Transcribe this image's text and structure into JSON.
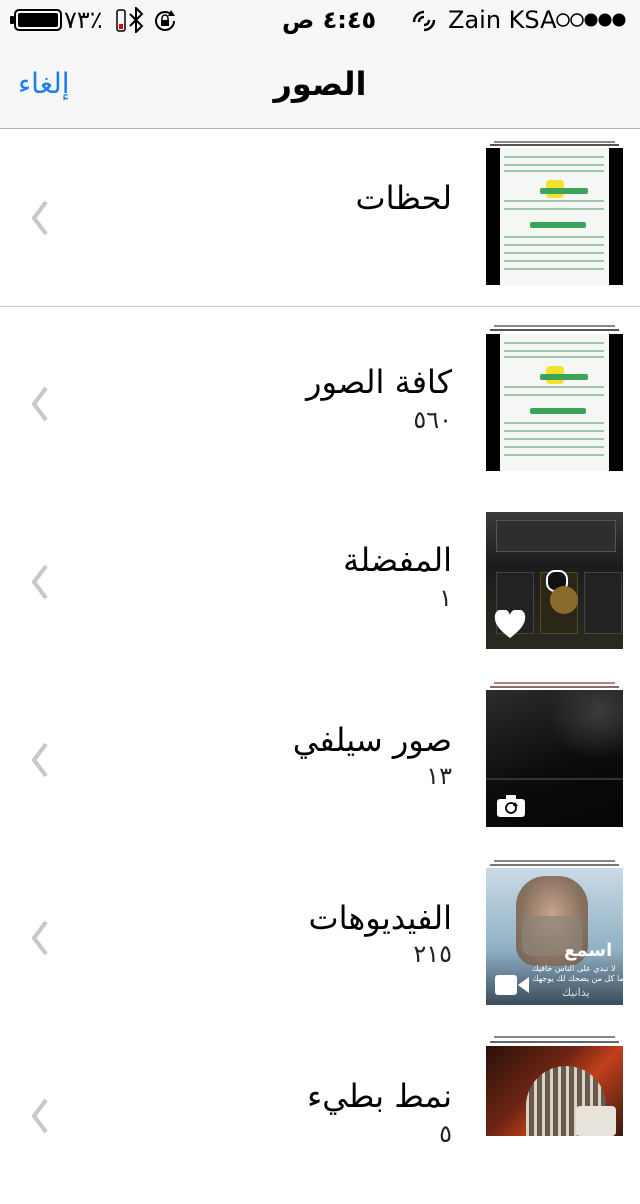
{
  "status_bar": {
    "battery_percent": "٧٣٪",
    "time": "٤:٤٥ ص",
    "carrier": "Zain KSA",
    "icons": [
      "battery-icon",
      "bluetooth-icon",
      "rotation-lock-icon",
      "wifi-calling-icon",
      "signal-dots-icon"
    ]
  },
  "nav": {
    "title": "الصور",
    "cancel_label": "إلغاء"
  },
  "albums": [
    {
      "label": "لحظات",
      "count": ""
    },
    {
      "label": "كافة الصور",
      "count": "٥٦٠"
    },
    {
      "label": "المفضلة",
      "count": "١"
    },
    {
      "label": "صور سيلفي",
      "count": "١٣"
    },
    {
      "label": "الفيديوهات",
      "count": "٢١٥"
    },
    {
      "label": "نمط بطيء",
      "count": "٥"
    }
  ],
  "thumb_text": {
    "quote_title": "اسمع",
    "quote_line1": "لا تبدي على الناس خافيك",
    "quote_line2": "ما كل من يضحك لك يوجهك",
    "quote_sig": "يدانيك"
  },
  "colors": {
    "accent": "#1b7ef6",
    "separator": "#c8c7cc",
    "chevron": "#c7c7cc"
  }
}
